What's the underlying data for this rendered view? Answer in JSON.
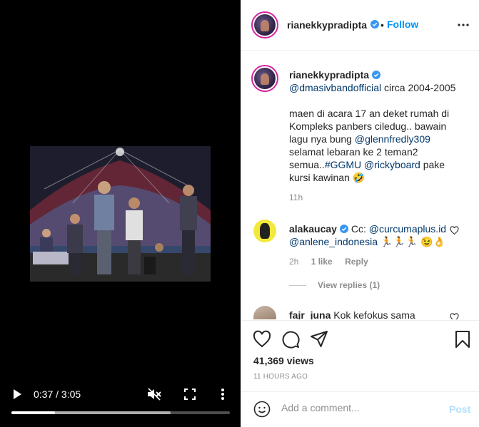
{
  "video": {
    "current_time": "0:37",
    "separator": " / ",
    "duration": "3:05",
    "played_fraction": 0.2,
    "buffered_fraction": 0.73
  },
  "post": {
    "author": "rianekkypradipta",
    "follow_label": "Follow",
    "dot": "•",
    "caption": {
      "mention": "@dmasivbandofficial",
      "line1_rest": " circa 2004-2005",
      "body_part1": "maen di acara 17 an deket rumah di Kompleks panbers ciledug.. bawain lagu nya bung ",
      "mention2": "@glennfredly309",
      "body_part2": " selamat lebaran ke 2 teman2 semua..",
      "hashtag": "#GGMU",
      "space": " ",
      "mention3": "@rickyboard",
      "body_part3": " pake kursi kawinan 🤣"
    },
    "time": "11h"
  },
  "comments": [
    {
      "author": "alakaucay",
      "prefix": "Cc: ",
      "mention1": "@curcumaplus.id",
      "mention2": "@anlene_indonesia",
      "emojis": " 🏃🏃🏃 😉👌",
      "time": "2h",
      "likes": "1 like",
      "reply": "Reply",
      "view_replies": "View replies (1)"
    },
    {
      "author": "fajr_juna",
      "text": "Kok kefokus sama"
    }
  ],
  "stats": {
    "views": "41,369 views",
    "time_ago": "11 HOURS AGO"
  },
  "composer": {
    "placeholder": "Add a comment...",
    "post_label": "Post"
  },
  "colors": {
    "accent": "#0095f6",
    "mention": "#00376b",
    "muted": "#8e8e8e",
    "post_disabled": "#b2dffc"
  }
}
